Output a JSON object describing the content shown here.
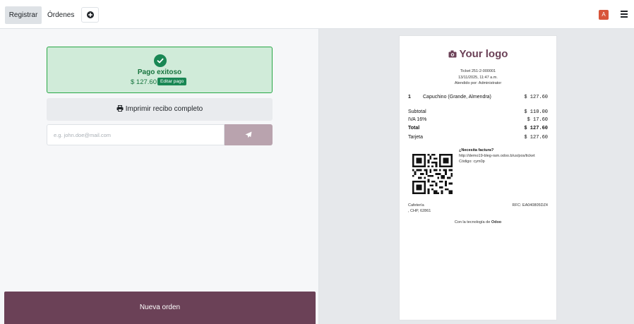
{
  "topbar": {
    "tabs": [
      {
        "label": "Registrar",
        "active": true
      },
      {
        "label": "Órdenes",
        "active": false
      }
    ],
    "add_icon": "plus-circle-icon",
    "avatar_letter": "A",
    "avatar_color": "#d8553a",
    "menu_icon": "hamburger-icon"
  },
  "payment": {
    "icon": "check-circle-icon",
    "title": "Pago exitoso",
    "amount": "$ 127.60",
    "edit_label": "Editar pago",
    "print_icon": "printer-icon",
    "print_label": "Imprimir recibo completo",
    "email_placeholder": "e.g. john.doe@mail.com",
    "email_value": "",
    "send_icon": "paper-plane-icon",
    "new_order_label": "Nueva orden"
  },
  "receipt": {
    "logo_icon": "camera-icon",
    "logo_text": "Your logo",
    "ticket": "Ticket 251-2-000001",
    "datetime": "13/11/2025, 11:47 a.m.",
    "served_by": "Atendido por: Administrator",
    "items": [
      {
        "qty": "1",
        "name": "Capuchino (Grande, Almendra)",
        "price": "$ 127.60"
      }
    ],
    "subtotal_label": "Subtotal",
    "subtotal": "$ 110.00",
    "tax_label": "IVA 16%",
    "tax": "$ 17.60",
    "total_label": "Total",
    "total": "$ 127.60",
    "payment_label": "Tarjeta",
    "payment_amount": "$ 127.60",
    "invoice_title": "¿Necesita factura?",
    "invoice_url": "http://demo19-bleg-ram.odoo.b/us/pos/ticket",
    "invoice_code": "Código: cym0p",
    "company_name": "Cafetería",
    "company_address": ", CHP, 62861",
    "rfc": "RFC: EA040805DZ4",
    "footer_prefix": "Con la tecnología de",
    "footer_brand": "Odoo"
  },
  "colors": {
    "brand": "#6b4157",
    "success_bg": "#d0ebd9",
    "success_text": "#17743e",
    "send_button": "#b9a3ae"
  }
}
